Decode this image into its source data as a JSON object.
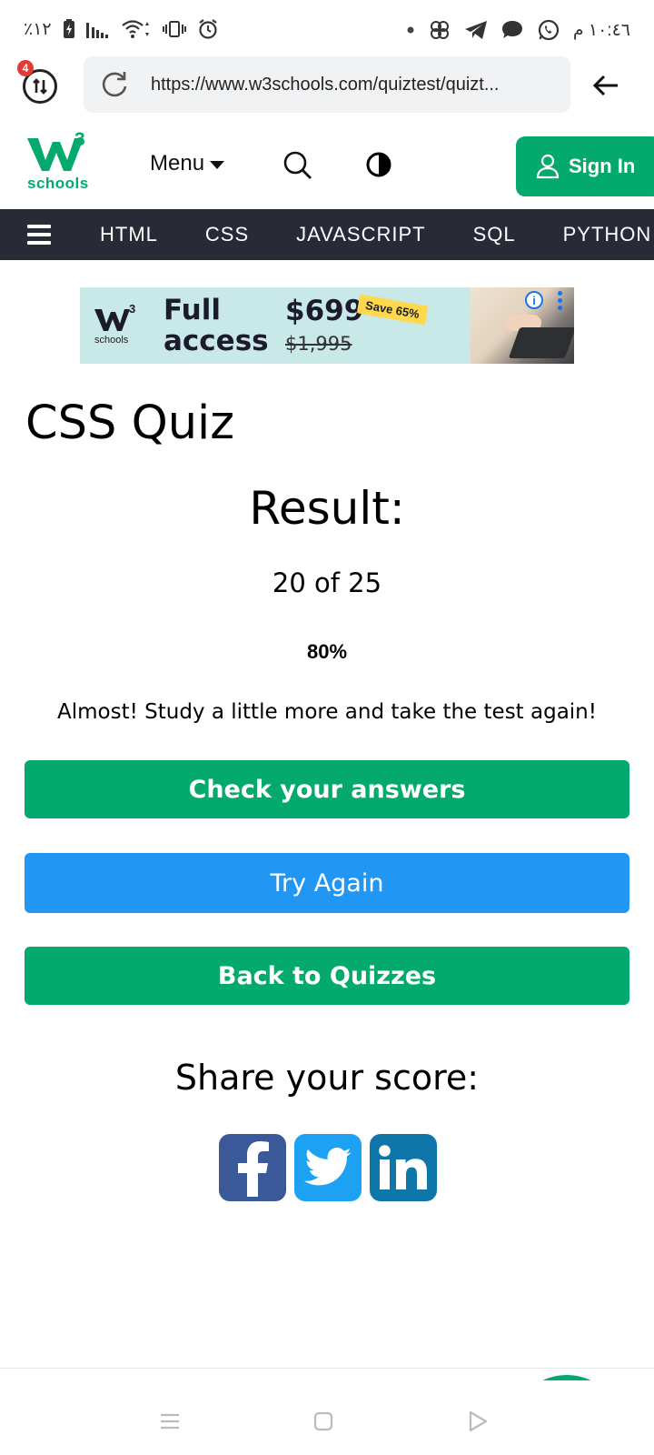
{
  "status_bar": {
    "battery": "٪١٢",
    "time": "١٠:٤٦ م"
  },
  "browser": {
    "tab_count": "4",
    "url": "https://www.w3schools.com/quiztest/quizt..."
  },
  "header": {
    "logo_superscript": "3",
    "logo_text": "schools",
    "menu_label": "Menu",
    "signin_label": "Sign In"
  },
  "nav": {
    "items": [
      "HTML",
      "CSS",
      "JAVASCRIPT",
      "SQL",
      "PYTHON"
    ]
  },
  "ad": {
    "logo_superscript": "3",
    "logo_text": "schools",
    "line1": "Full",
    "line2": "access",
    "price": "$699",
    "old_price": "$1,995",
    "badge": "Save 65%"
  },
  "quiz": {
    "title": "CSS Quiz",
    "result_label": "Result:",
    "score": "20 of 25",
    "percent": "80%",
    "message": "Almost! Study a little more and take the test again!"
  },
  "buttons": {
    "check": "Check your answers",
    "try_again": "Try Again",
    "back": "Back to Quizzes"
  },
  "share": {
    "label": "Share your score:"
  },
  "colors": {
    "brand_green": "#04aa6d",
    "nav_dark": "#282a35",
    "button_blue": "#2196f3",
    "facebook": "#3b5998",
    "twitter": "#1da1f2",
    "linkedin": "#0e76a8"
  }
}
